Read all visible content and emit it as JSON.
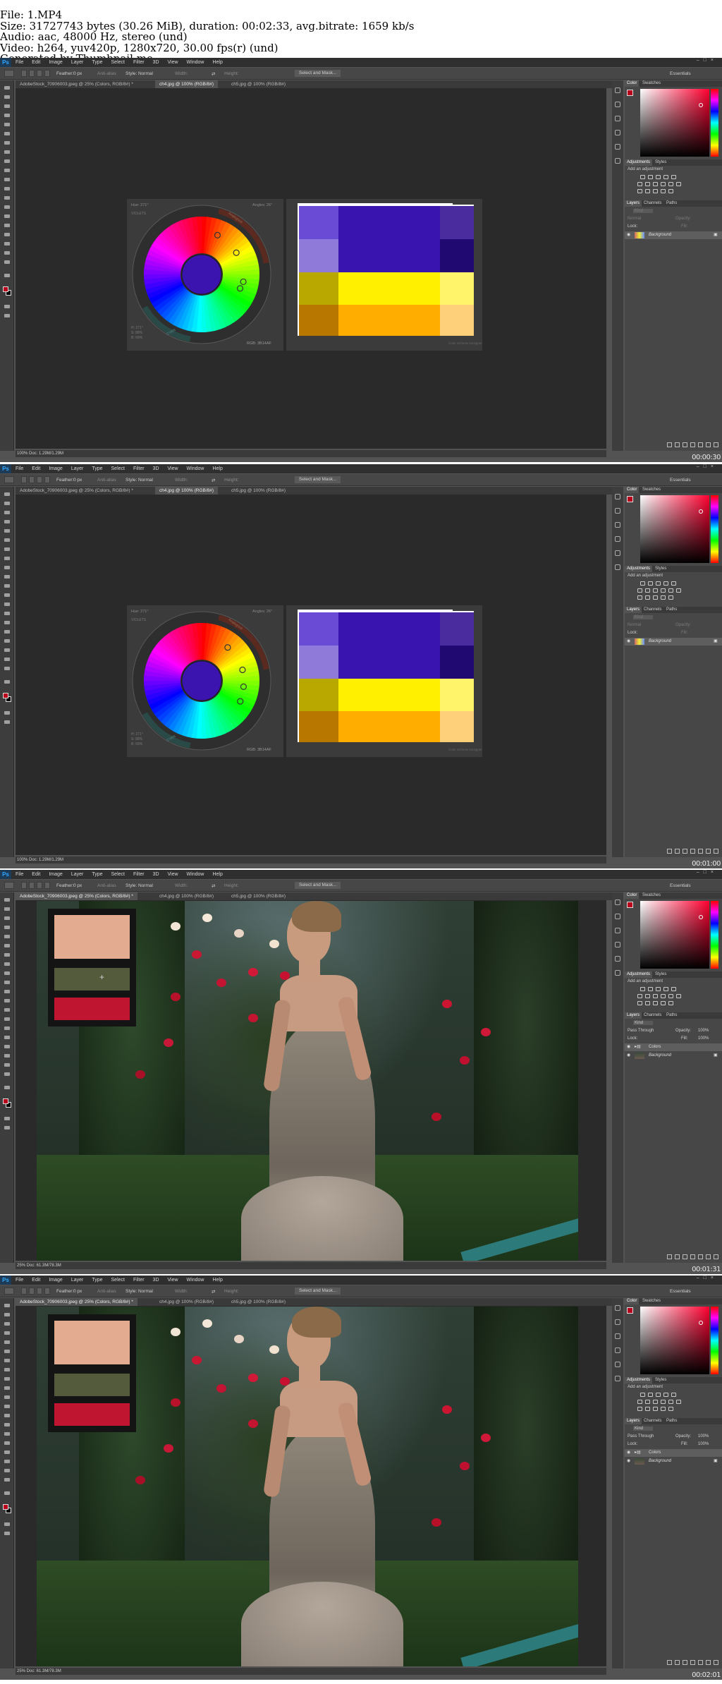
{
  "header_lines": [
    "File: 1.MP4",
    "Size: 31727743 bytes (30.26 MiB), duration: 00:02:33, avg.bitrate: 1659 kb/s",
    "Audio: aac, 48000 Hz, stereo (und)",
    "Video: h264, yuv420p, 1280x720, 30.00 fps(r) (und)",
    "Generated by Thumbnail me"
  ],
  "app": {
    "logo": "Ps"
  },
  "menu": [
    "File",
    "Edit",
    "Image",
    "Layer",
    "Type",
    "Select",
    "Filter",
    "3D",
    "View",
    "Window",
    "Help"
  ],
  "options": {
    "feather": "Feather:",
    "feather_val": "0 px",
    "antialias": "Anti-alias",
    "style": "Style:",
    "style_val": "Normal",
    "width": "Width:",
    "height": "Height:",
    "select_mask": "Select and Mask...",
    "essentials": "Essentials"
  },
  "frames": [
    {
      "tabs": [
        "AdobeStock_70906003.jpeg @ 25% (Colors, RGB/8#) *",
        "ch4.jpg @ 100% (RGB/8#)",
        "ch5.jpg @ 100% (RGB/8#)"
      ],
      "active_tab": 1,
      "status": "100%     Doc: 1.29M/1.29M",
      "time": "00:00:30"
    },
    {
      "tabs": [
        "AdobeStock_70906003.jpeg @ 25% (Colors, RGB/8#) *",
        "ch4.jpg @ 100% (RGB/8#)",
        "ch5.jpg @ 100% (RGB/8#)"
      ],
      "active_tab": 1,
      "status": "100%     Doc: 1.29M/1.29M",
      "time": "00:01:00"
    },
    {
      "tabs": [
        "AdobeStock_70906003.jpeg @ 25% (Colors, RGB/8#) *",
        "ch4.jpg @ 100% (RGB/8#)",
        "ch5.jpg @ 100% (RGB/8#)"
      ],
      "active_tab": 0,
      "status": "25%     Doc: 61.3M/78.3M",
      "time": "00:01:31"
    },
    {
      "tabs": [
        "AdobeStock_70906003.jpeg @ 25% (Colors, RGB/8#) *",
        "ch4.jpg @ 100% (RGB/8#)",
        "ch5.jpg @ 100% (RGB/8#)"
      ],
      "active_tab": 0,
      "status": "25%     Doc: 61.3M/78.3M",
      "time": "00:02:01"
    }
  ],
  "panels": {
    "color_tabs": [
      "Color",
      "Swatches"
    ],
    "adj_tabs": [
      "Adjustments",
      "Styles"
    ],
    "add_adjustment": "Add an adjustment",
    "layer_tabs": [
      "Layers",
      "Channels",
      "Paths"
    ],
    "kind": "Kind",
    "normal": "Normal",
    "pass_through": "Pass Through",
    "opacity": "Opacity:",
    "opacity_val": "100%",
    "lock": "Lock:",
    "fill": "Fill:",
    "fill_val": "100%",
    "layer_background": "Background",
    "layer_colors": "Colors"
  },
  "wheel": {
    "hue": "Hue: 271°",
    "angles": "Angles: 26°",
    "rgb": "RGB: 3B14AF",
    "labels": [
      "VIOLETS",
      "Analogous",
      "CYAN"
    ],
    "lightness": [
      "H: 271°",
      "S: 88%",
      "B: 69%"
    ]
  },
  "palette": {
    "colors": [
      "#6a4bd6",
      "#3a14ae",
      "#4a2c9e",
      "#8f79d9",
      "#200a72",
      "#b8a800",
      "#fff000",
      "#fff46a",
      "#b87800",
      "#ffae00",
      "#ffd07a"
    ],
    "caption": "Color Scheme Designer"
  },
  "swatches": [
    "#e3ab90",
    "#545b3d",
    "#c01530"
  ],
  "colors": {
    "fg": "#b8001c",
    "bg": "#000000"
  }
}
